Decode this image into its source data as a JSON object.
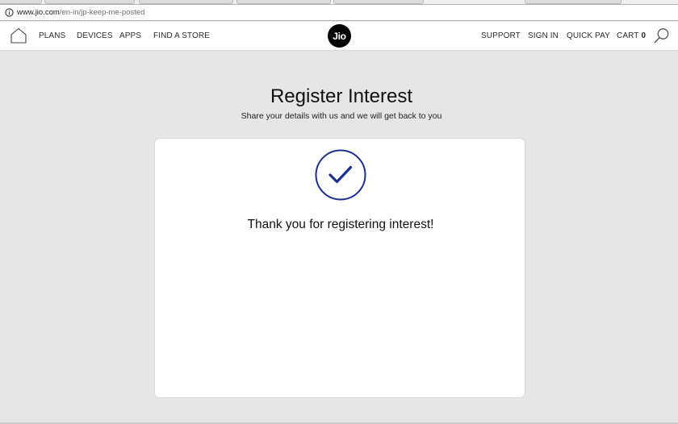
{
  "browser": {
    "url_host": "www.jio.com",
    "url_path": "/en-in/jp-keep-me-posted"
  },
  "header": {
    "nav_left": [
      "PLANS",
      "DEVICES",
      "APPS",
      "FIND A STORE"
    ],
    "logo_text": "Jio",
    "nav_right": {
      "support": "SUPPORT",
      "sign_in": "SIGN IN",
      "quick_pay": "QUICK PAY",
      "cart_label": "CART",
      "cart_count": "0"
    },
    "icons": [
      "home-icon",
      "search-icon"
    ]
  },
  "main": {
    "title": "Register Interest",
    "subtitle": "Share your details with us and we will get back to you",
    "confirmation": {
      "icon": "checkmark-circle-icon",
      "message": "Thank you for registering interest!"
    }
  },
  "colors": {
    "page_background": "#e6e6e6",
    "logo_background": "#050505",
    "check_accent": "#1b2f8f"
  }
}
